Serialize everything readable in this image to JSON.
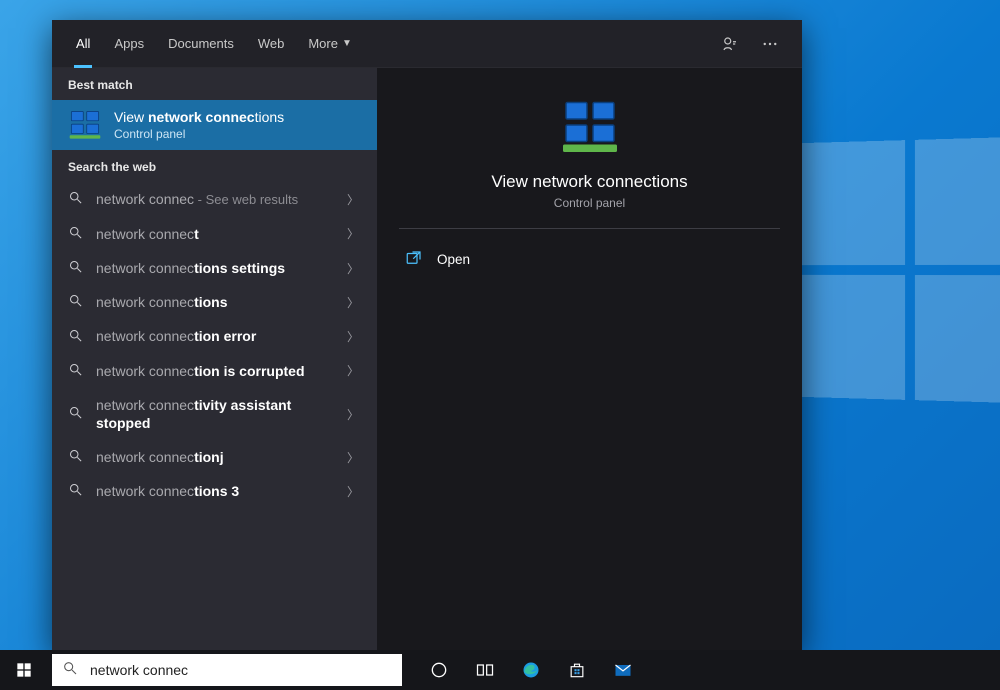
{
  "tabs": {
    "all": "All",
    "apps": "Apps",
    "documents": "Documents",
    "web": "Web",
    "more": "More"
  },
  "sections": {
    "best_match": "Best match",
    "search_web": "Search the web"
  },
  "best_match": {
    "title_prefix": "View ",
    "title_bold": "network connec",
    "title_suffix": "tions",
    "subtitle": "Control panel"
  },
  "web_results": [
    {
      "pre": "",
      "bold": "network connec",
      "post": "",
      "suffix": " - See web results"
    },
    {
      "pre": "",
      "bold": "network connec",
      "post": "t",
      "suffix": ""
    },
    {
      "pre": "",
      "bold": "network connec",
      "post": "tions settings",
      "suffix": ""
    },
    {
      "pre": "",
      "bold": "network connec",
      "post": "tions",
      "suffix": ""
    },
    {
      "pre": "",
      "bold": "network connec",
      "post": "tion error",
      "suffix": ""
    },
    {
      "pre": "",
      "bold": "network connec",
      "post": "tion is corrupted",
      "suffix": ""
    },
    {
      "pre": "",
      "bold": "network connec",
      "post": "tivity assistant stopped",
      "suffix": ""
    },
    {
      "pre": "",
      "bold": "network connec",
      "post": "tionj",
      "suffix": ""
    },
    {
      "pre": "",
      "bold": "network connec",
      "post": "tions 3",
      "suffix": ""
    }
  ],
  "preview": {
    "title": "View network connections",
    "subtitle": "Control panel",
    "actions": {
      "open": "Open"
    }
  },
  "taskbar": {
    "search_value": "network connec"
  }
}
